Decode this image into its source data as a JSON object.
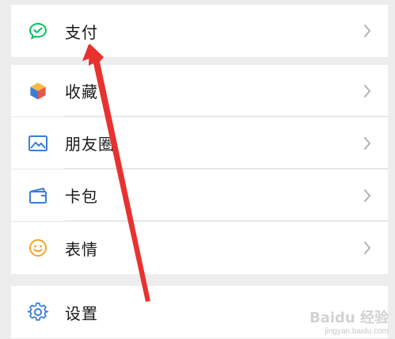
{
  "menu": {
    "pay": {
      "label": "支付",
      "icon": "wallet-pay-icon"
    },
    "favorites": {
      "label": "收藏",
      "icon": "favorites-cube-icon"
    },
    "moments": {
      "label": "朋友圈",
      "icon": "photo-moments-icon"
    },
    "cards": {
      "label": "卡包",
      "icon": "card-wallet-icon"
    },
    "stickers": {
      "label": "表情",
      "icon": "smiley-icon"
    },
    "settings": {
      "label": "设置",
      "icon": "gear-icon"
    }
  },
  "watermark": {
    "brand": "Baidu 经验",
    "url": "jingyan.baidu.com"
  },
  "colors": {
    "accent_green": "#07c160",
    "arrow_red": "#e8322f",
    "icon_blue": "#3b7dd8",
    "smiley_orange": "#f5a623"
  }
}
